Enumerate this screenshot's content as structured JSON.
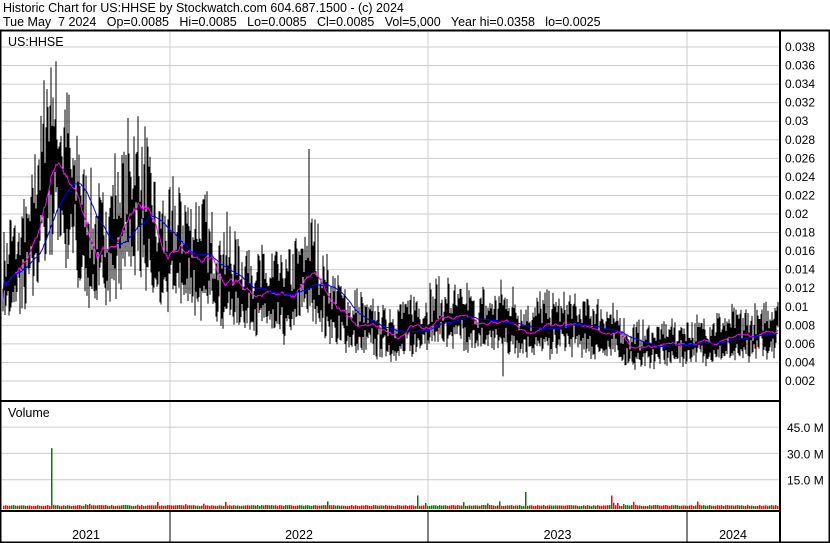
{
  "header": {
    "title": "Historic Chart for US:HHSE by Stockwatch.com 604.687.1500 - (c) 2024",
    "quote": "Tue May  7 2024   Op=0.0085   Hi=0.0085   Lo=0.0085   Cl=0.0085   Vol=5,000   Year hi=0.0358   lo=0.0025"
  },
  "chart_data": [
    {
      "type": "line",
      "title": "US:HHSE",
      "panel": "price",
      "yticks": [
        "0.002",
        "0.004",
        "0.006",
        "0.008",
        "0.01",
        "0.012",
        "0.014",
        "0.016",
        "0.018",
        "0.02",
        "0.022",
        "0.024",
        "0.026",
        "0.028",
        "0.03",
        "0.032",
        "0.034",
        "0.036",
        "0.038"
      ],
      "ylim": [
        0,
        0.0396
      ],
      "x_range": [
        "2021-05",
        "2024-05"
      ],
      "grid": true,
      "series_colors": {
        "bars": "#000000",
        "down_ticks": "#ff0000",
        "ma_short": "#ff00ff",
        "ma_long": "#0000ff"
      },
      "monthly_close": [
        [
          "2021-05",
          0.013
        ],
        [
          "2021-06",
          0.016
        ],
        [
          "2021-07",
          0.027
        ],
        [
          "2021-08",
          0.021
        ],
        [
          "2021-09",
          0.015
        ],
        [
          "2021-10",
          0.018
        ],
        [
          "2021-11",
          0.022
        ],
        [
          "2021-12",
          0.015
        ],
        [
          "2022-01",
          0.016
        ],
        [
          "2022-02",
          0.015
        ],
        [
          "2022-03",
          0.013
        ],
        [
          "2022-04",
          0.012
        ],
        [
          "2022-05",
          0.011
        ],
        [
          "2022-06",
          0.0105
        ],
        [
          "2022-07",
          0.014
        ],
        [
          "2022-08",
          0.01
        ],
        [
          "2022-09",
          0.008
        ],
        [
          "2022-10",
          0.0075
        ],
        [
          "2022-11",
          0.007
        ],
        [
          "2022-12",
          0.008
        ],
        [
          "2023-01",
          0.009
        ],
        [
          "2023-02",
          0.0085
        ],
        [
          "2023-03",
          0.008
        ],
        [
          "2023-04",
          0.0085
        ],
        [
          "2023-05",
          0.0075
        ],
        [
          "2023-06",
          0.0078
        ],
        [
          "2023-07",
          0.008
        ],
        [
          "2023-08",
          0.0075
        ],
        [
          "2023-09",
          0.0072
        ],
        [
          "2023-10",
          0.0055
        ],
        [
          "2023-11",
          0.0058
        ],
        [
          "2023-12",
          0.006
        ],
        [
          "2024-01",
          0.0062
        ],
        [
          "2024-02",
          0.0065
        ],
        [
          "2024-03",
          0.0066
        ],
        [
          "2024-04",
          0.007
        ],
        [
          "2024-05",
          0.0085
        ]
      ],
      "highlights": [
        [
          "2021-07",
          0.0358
        ],
        [
          "2022-07",
          0.027
        ],
        [
          "2023-04",
          0.0025
        ]
      ]
    },
    {
      "type": "bar",
      "title": "Volume",
      "panel": "volume",
      "yticks": [
        "15.0 M",
        "30.0 M",
        "45.0 M"
      ],
      "ylim": [
        0,
        54000000
      ],
      "spikes": [
        [
          "2021-07",
          33000000
        ],
        [
          "2022-12",
          6000000
        ],
        [
          "2023-05",
          8000000
        ],
        [
          "2023-09",
          6000000
        ]
      ],
      "colors": {
        "up": "#008000",
        "down": "#ff0000"
      }
    }
  ],
  "xaxis": {
    "years": [
      "2021",
      "2022",
      "2023",
      "2024"
    ]
  }
}
